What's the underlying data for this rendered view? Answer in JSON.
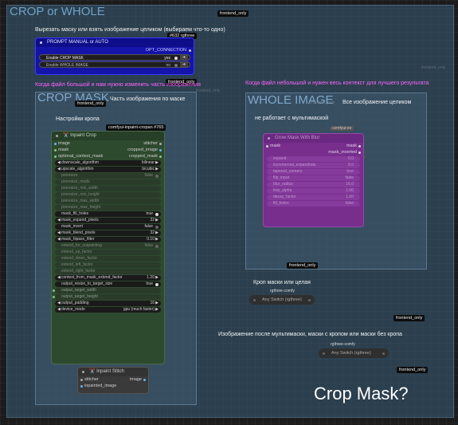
{
  "groups": {
    "main_title": "CROP or WHOLE",
    "crop_title": "CROP MASK",
    "whole_title": "WHOLE IMAGE"
  },
  "badges": {
    "frontend_only": "frontend_only",
    "rgthree_id": "#632 rgthree",
    "crop_id": "comfyui-inpaint-cropan  #765",
    "whole_id": "comfyui-ee",
    "rgthree_comfy": "rgthree-comfy"
  },
  "notes": {
    "cut_mask": "Вырезать маску или взять изображение целиком (выбираем что-то одно)",
    "big_file": "Когда файл большой и нам нужно изменить часть изображения",
    "small_file": "Когда файл небольшой и нужен весь контекст для лучшего результата",
    "part_by_mask": "Часть изображения по маске",
    "whole_image": "Все изображение целиком",
    "crop_settings": "Настройки кропа",
    "not_multimask": "не работает с мультимаской",
    "crop_or_whole": "Кроп маски или целая",
    "after_multimask": "Изображение после мультимаски, маски с кропом или маски без кропа",
    "crop_mask_q": "Crop Mask?"
  },
  "prompt_node": {
    "title": "PROMPT MANUAL or AUTO",
    "output": "OPT_CONNECTION",
    "rows": [
      {
        "label": "Enable CROP MASK",
        "value": "yes"
      },
      {
        "label": "Enable WHOLE IMAGE",
        "value": "no"
      }
    ]
  },
  "inpaint_crop": {
    "title": "✂️ Inpaint Crop",
    "inputs": [
      "image",
      "mask",
      "optional_context_mask"
    ],
    "outputs": [
      "stitcher",
      "cropped_image",
      "cropped_mask"
    ],
    "widgets": [
      {
        "label": "downscale_algorithm",
        "value": "bilinear",
        "active": true,
        "kind": "combo"
      },
      {
        "label": "upscale_algorithm",
        "value": "bicubic",
        "active": true,
        "kind": "combo"
      },
      {
        "label": "preresize",
        "value": "false",
        "active": false,
        "kind": "toggle"
      },
      {
        "label": "preresize_mode",
        "value": "",
        "active": false,
        "kind": "hidden"
      },
      {
        "label": "preresize_min_width",
        "value": "",
        "active": false,
        "kind": "hidden"
      },
      {
        "label": "preresize_min_height",
        "value": "",
        "active": false,
        "kind": "hidden"
      },
      {
        "label": "preresize_max_width",
        "value": "",
        "active": false,
        "kind": "hidden"
      },
      {
        "label": "preresize_max_height",
        "value": "",
        "active": false,
        "kind": "hidden"
      },
      {
        "label": "mask_fill_holes",
        "value": "true",
        "active": true,
        "kind": "toggle"
      },
      {
        "label": "mask_expand_pixels",
        "value": "32",
        "active": true,
        "kind": "number"
      },
      {
        "label": "mask_invert",
        "value": "false",
        "active": true,
        "kind": "toggle"
      },
      {
        "label": "mask_blend_pixels",
        "value": "32",
        "active": true,
        "kind": "number"
      },
      {
        "label": "mask_hipass_filter",
        "value": "0.10",
        "active": true,
        "kind": "number"
      },
      {
        "label": "extend_for_outpainting",
        "value": "false",
        "active": false,
        "kind": "toggle"
      },
      {
        "label": "extend_up_factor",
        "value": "",
        "active": false,
        "kind": "hidden"
      },
      {
        "label": "extend_down_factor",
        "value": "",
        "active": false,
        "kind": "hidden"
      },
      {
        "label": "extend_left_factor",
        "value": "",
        "active": false,
        "kind": "hidden"
      },
      {
        "label": "extend_right_factor",
        "value": "",
        "active": false,
        "kind": "hidden"
      },
      {
        "label": "context_from_mask_extend_factor",
        "value": "1.20",
        "active": true,
        "kind": "number"
      },
      {
        "label": "output_resize_to_target_size",
        "value": "true",
        "active": true,
        "kind": "toggle"
      },
      {
        "label": "output_target_width",
        "value": "",
        "active": true,
        "kind": "input"
      },
      {
        "label": "output_target_height",
        "value": "",
        "active": true,
        "kind": "input"
      },
      {
        "label": "output_padding",
        "value": "16",
        "active": true,
        "kind": "combo"
      },
      {
        "label": "device_mode",
        "value": "gpu (much faster)",
        "active": true,
        "kind": "combo"
      }
    ]
  },
  "inpaint_stitch": {
    "title": "✂️ Inpaint Stitch",
    "inputs": [
      "stitcher",
      "inpainted_image"
    ],
    "output": "image"
  },
  "mask_node": {
    "title": "Grow Mask With Blur",
    "input": "mask",
    "outputs": [
      "mask",
      "mask_inverted"
    ],
    "widgets": [
      {
        "label": "expand",
        "value": "0.0"
      },
      {
        "label": "incremental_expandrate",
        "value": "0.0"
      },
      {
        "label": "tapered_corners",
        "value": "true"
      },
      {
        "label": "flip_input",
        "value": "false"
      },
      {
        "label": "blur_radius",
        "value": "16.0"
      },
      {
        "label": "lerp_alpha",
        "value": "1.00"
      },
      {
        "label": "decay_factor",
        "value": "1.00"
      },
      {
        "label": "fill_holes",
        "value": "false"
      }
    ]
  },
  "switches": [
    {
      "title": "Any Switch (rgthree)"
    },
    {
      "title": "Any Switch (rgthree)"
    }
  ],
  "colors": {
    "group_fill": "#3a5a74",
    "prompt_node_bg": "#1414a8",
    "crop_node_bg": "#2e4a2e",
    "mask_node_bg": "#7b2d90",
    "note_pink": "#ff66ff"
  }
}
